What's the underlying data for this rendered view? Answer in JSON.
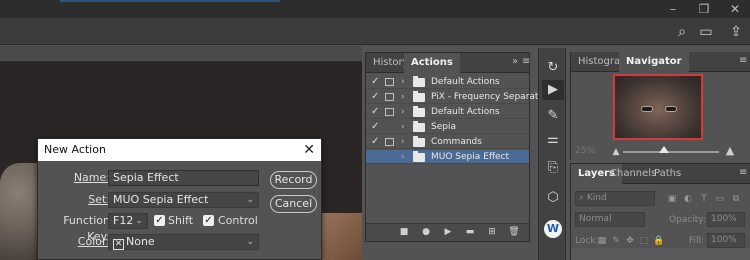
{
  "colors": {
    "accent": "#4b6a94",
    "app_bg": "#535353",
    "close_red": "#d43a3a"
  },
  "window_controls": {
    "minimize_icon": "minimize-icon",
    "restore_icon": "restore-icon",
    "close_icon": "close-icon"
  },
  "options_bar": {
    "icons": [
      "search-icon",
      "workspace-icon",
      "share-icon"
    ]
  },
  "dialog": {
    "title": "New Action",
    "name_label": "Name:",
    "name_value": "Sepia Effect",
    "set_label": "Set:",
    "set_value": "MUO Sepia Effect",
    "function_key_label": "Function Key:",
    "function_key_value": "F12",
    "shift_label": "Shift",
    "shift_checked": true,
    "control_label": "Control",
    "control_checked": true,
    "color_label": "Color:",
    "color_value": "None",
    "record_label": "Record",
    "cancel_label": "Cancel"
  },
  "actions_panel": {
    "tabs": [
      "History",
      "Actions"
    ],
    "active_tab": "Actions",
    "items": [
      {
        "checked": true,
        "dialog_box": true,
        "name": "Default Actions",
        "selected": false
      },
      {
        "checked": true,
        "dialog_box": true,
        "name": "PiX - Frequency Separation",
        "selected": false
      },
      {
        "checked": true,
        "dialog_box": true,
        "name": "Default Actions",
        "selected": false
      },
      {
        "checked": true,
        "dialog_box": false,
        "name": "Sepia",
        "selected": false
      },
      {
        "checked": true,
        "dialog_box": true,
        "name": "Commands",
        "selected": false
      },
      {
        "checked": false,
        "dialog_box": false,
        "name": "MUO Sepia Effect",
        "selected": true
      }
    ],
    "footer_icons": [
      "stop-icon",
      "record-icon",
      "play-icon",
      "new-set-icon",
      "new-action-icon",
      "delete-icon"
    ]
  },
  "toolstrip": {
    "icons": [
      "history-brush-icon",
      "play-icon",
      "brush-settings-icon",
      "adjustments-icon",
      "clone-source-icon",
      "3d-icon",
      "w-plugin-icon"
    ]
  },
  "navigator_panel": {
    "tabs": [
      "Histogram",
      "Navigator"
    ],
    "active_tab": "Navigator",
    "zoom": "25%"
  },
  "layers_panel": {
    "tabs": [
      "Layers",
      "Channels",
      "Paths"
    ],
    "active_tab": "Layers",
    "filter_placeholder": "Kind",
    "blend_mode": "Normal",
    "opacity_label": "Opacity:",
    "opacity_value": "100%",
    "lock_label": "Lock:",
    "fill_label": "Fill:",
    "fill_value": "100%"
  }
}
